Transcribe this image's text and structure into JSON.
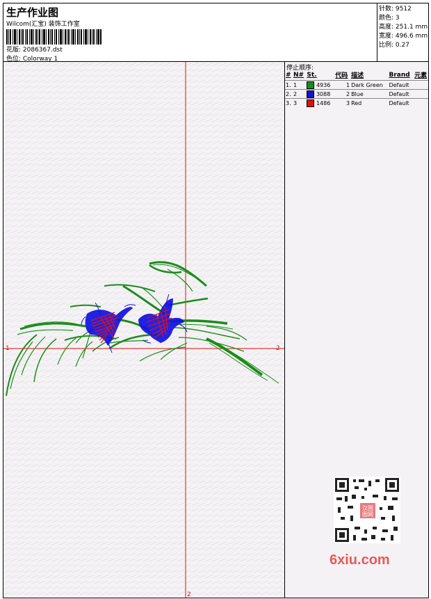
{
  "header": {
    "title": "生产作业图",
    "studio": "Wilcom(汇宝) 装饰工作室",
    "design_label": "花版: 2086367.dst",
    "colorway_label": "色位: Colorway 1"
  },
  "stats": [
    {
      "label": "针数:",
      "value": "9512"
    },
    {
      "label": "颜色:",
      "value": "3"
    },
    {
      "label": "高度:",
      "value": "251.1 mm"
    },
    {
      "label": "宽度:",
      "value": "496.6 mm"
    },
    {
      "label": "比例:",
      "value": "0.27"
    }
  ],
  "stop_sequence": {
    "title": "停止顺序:",
    "columns": [
      "#",
      "N#",
      "St.",
      "代码",
      "描述",
      "Brand",
      "元素"
    ],
    "rows": [
      {
        "index": "1.",
        "n": "1",
        "color": "#1a8c1a",
        "stitches": "4936",
        "code": "1",
        "description": "Dark Green",
        "brand": "Default"
      },
      {
        "index": "2.",
        "n": "2",
        "color": "#1010e0",
        "stitches": "3088",
        "code": "2",
        "description": "Blue",
        "brand": "Default"
      },
      {
        "index": "3.",
        "n": "3",
        "color": "#e01010",
        "stitches": "1486",
        "code": "3",
        "description": "Red",
        "brand": "Default"
      }
    ]
  },
  "canvas": {
    "axis_labels": {
      "left": "1",
      "right": "2",
      "bottom": "2"
    },
    "design_colors": {
      "leaf": "#1a8c1a",
      "petal_blue": "#1010e0",
      "petal_red": "#e01010",
      "axis": "#e01010"
    }
  },
  "watermark": {
    "text": "6xiu.com",
    "seal_top": "汉国",
    "seal_bottom": "图网"
  }
}
